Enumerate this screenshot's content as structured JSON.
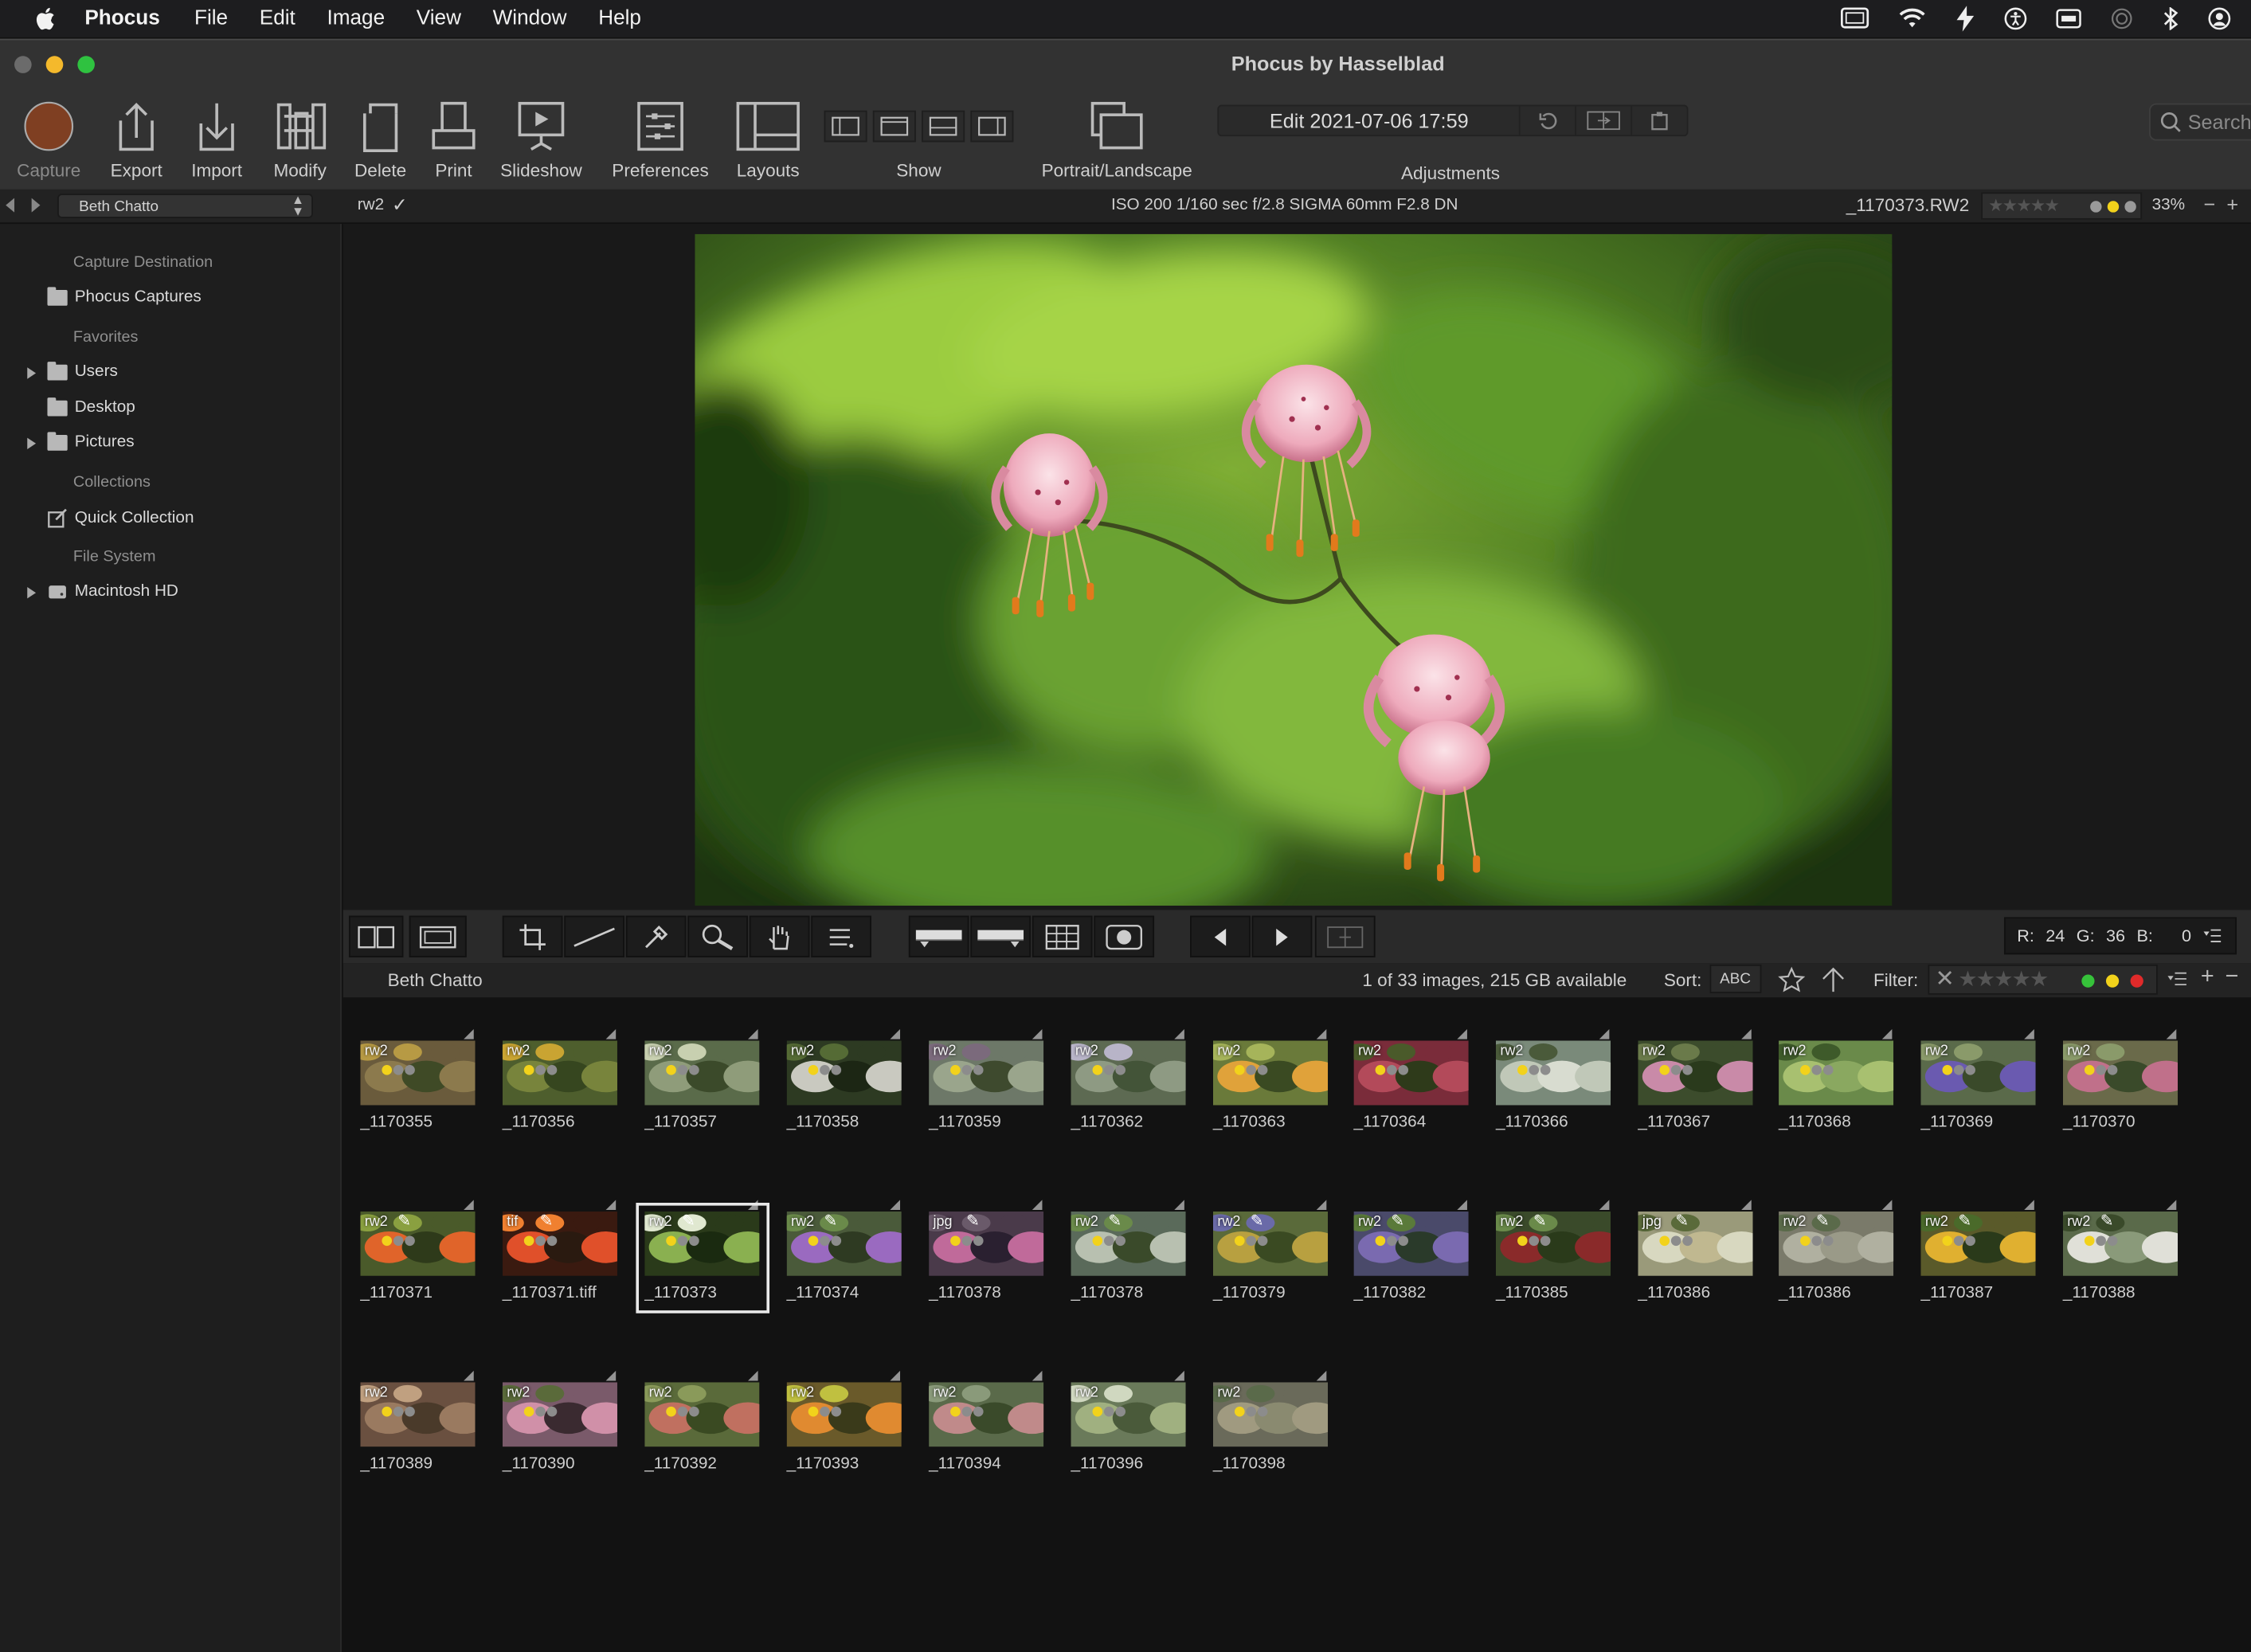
{
  "menubar": {
    "app": "Phocus",
    "items": [
      "File",
      "Edit",
      "Image",
      "View",
      "Window",
      "Help"
    ]
  },
  "window": {
    "title": "Phocus by Hasselblad"
  },
  "toolbar": {
    "capture": "Capture",
    "export": "Export",
    "import": "Import",
    "modify": "Modify",
    "delete": "Delete",
    "print": "Print",
    "slideshow": "Slideshow",
    "preferences": "Preferences",
    "layouts": "Layouts",
    "show": "Show",
    "portrait_landscape": "Portrait/Landscape",
    "adjustments": "Adjustments",
    "edit_label": "Edit 2021-07-06 17:59",
    "search_placeholder": "Search"
  },
  "infobar": {
    "folder_select": "Beth Chatto",
    "format": "rw2",
    "exif": "ISO 200  1/160 sec  f/2.8  SIGMA 60mm F2.8 DN",
    "filename": "_1170373.RW2",
    "zoom": "33%",
    "minus": "−",
    "plus": "+"
  },
  "sidebar": {
    "capture_destination": "Capture Destination",
    "phocus_captures": "Phocus Captures",
    "favorites": "Favorites",
    "users": "Users",
    "desktop": "Desktop",
    "pictures": "Pictures",
    "collections": "Collections",
    "quick_collection": "Quick Collection",
    "file_system": "File System",
    "macintosh_hd": "Macintosh HD"
  },
  "readout": {
    "r_label": "R:",
    "r": "24",
    "g_label": "G:",
    "g": "36",
    "b_label": "B:",
    "b": "0"
  },
  "browser": {
    "folder": "Beth Chatto",
    "count": "1 of 33 images, 215 GB available",
    "sort_label": "Sort:",
    "sort_value": "ABC",
    "filter_label": "Filter:"
  },
  "thumbnails": [
    {
      "name": "_1170355",
      "type": "rw2"
    },
    {
      "name": "_1170356",
      "type": "rw2"
    },
    {
      "name": "_1170357",
      "type": "rw2"
    },
    {
      "name": "_1170358",
      "type": "rw2"
    },
    {
      "name": "_1170359",
      "type": "rw2"
    },
    {
      "name": "_1170362",
      "type": "rw2"
    },
    {
      "name": "_1170363",
      "type": "rw2"
    },
    {
      "name": "_1170364",
      "type": "rw2"
    },
    {
      "name": "_1170366",
      "type": "rw2"
    },
    {
      "name": "_1170367",
      "type": "rw2"
    },
    {
      "name": "_1170368",
      "type": "rw2"
    },
    {
      "name": "_1170369",
      "type": "rw2"
    },
    {
      "name": "_1170370",
      "type": "rw2"
    },
    {
      "name": "_1170371",
      "type": "rw2"
    },
    {
      "name": "_1170371.tiff",
      "type": "tif"
    },
    {
      "name": "_1170373",
      "type": "rw2"
    },
    {
      "name": "_1170374",
      "type": "rw2"
    },
    {
      "name": "_1170378",
      "type": "jpg"
    },
    {
      "name": "_1170378",
      "type": "rw2"
    },
    {
      "name": "_1170379",
      "type": "rw2"
    },
    {
      "name": "_1170382",
      "type": "rw2"
    },
    {
      "name": "_1170385",
      "type": "rw2"
    },
    {
      "name": "_1170386",
      "type": "jpg"
    },
    {
      "name": "_1170386",
      "type": "rw2"
    },
    {
      "name": "_1170387",
      "type": "rw2"
    },
    {
      "name": "_1170388",
      "type": "rw2"
    },
    {
      "name": "_1170389",
      "type": "rw2"
    },
    {
      "name": "_1170390",
      "type": "rw2"
    },
    {
      "name": "_1170392",
      "type": "rw2"
    },
    {
      "name": "_1170393",
      "type": "rw2"
    },
    {
      "name": "_1170394",
      "type": "rw2"
    },
    {
      "name": "_1170396",
      "type": "rw2"
    },
    {
      "name": "_1170398",
      "type": "rw2"
    }
  ],
  "colors": {
    "accent_yellow": "#f2d21b",
    "capture_brown": "#8a4a2a",
    "label_green": "#36c23a",
    "label_red": "#e02a2a"
  }
}
